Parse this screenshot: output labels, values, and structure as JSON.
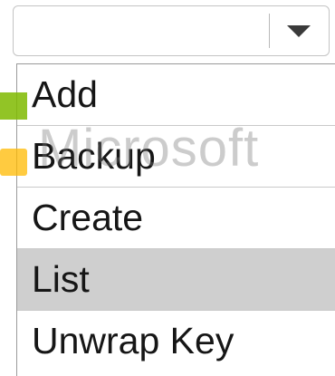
{
  "select": {
    "value": "",
    "options": [
      "Add",
      "Backup",
      "Create",
      "List",
      "Unwrap Key"
    ],
    "highlighted_option": "List"
  },
  "watermark": {
    "text": "Microsoft",
    "colors": [
      "#7fba00",
      "#f25022",
      "#ffb900"
    ]
  },
  "icons": {
    "dropdown": "chevron-down-icon"
  }
}
